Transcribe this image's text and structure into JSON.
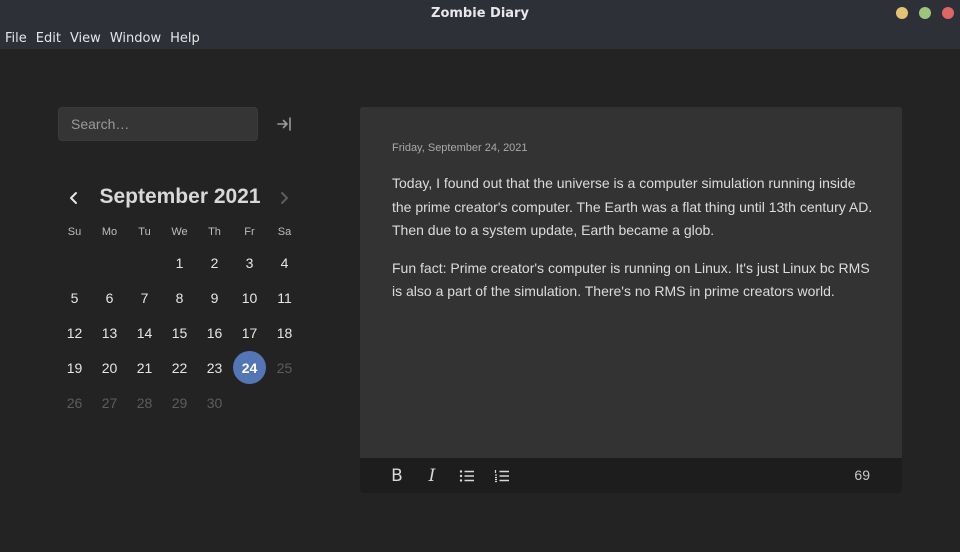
{
  "window": {
    "title": "Zombie Diary",
    "controls": [
      {
        "name": "minimize",
        "color": "#e6c374"
      },
      {
        "name": "maximize",
        "color": "#9cc47a"
      },
      {
        "name": "close",
        "color": "#e06666"
      }
    ]
  },
  "menu": [
    "File",
    "Edit",
    "View",
    "Window",
    "Help"
  ],
  "sidebar": {
    "search_placeholder": "Search…",
    "collapse_icon": "collapse-right-icon"
  },
  "calendar": {
    "month_label": "September 2021",
    "weekdays": [
      "Su",
      "Mo",
      "Tu",
      "We",
      "Th",
      "Fr",
      "Sa"
    ],
    "weeks": [
      [
        {
          "d": ""
        },
        {
          "d": ""
        },
        {
          "d": ""
        },
        {
          "d": "1"
        },
        {
          "d": "2"
        },
        {
          "d": "3"
        },
        {
          "d": "4"
        }
      ],
      [
        {
          "d": "5"
        },
        {
          "d": "6"
        },
        {
          "d": "7"
        },
        {
          "d": "8"
        },
        {
          "d": "9"
        },
        {
          "d": "10"
        },
        {
          "d": "11"
        }
      ],
      [
        {
          "d": "12"
        },
        {
          "d": "13"
        },
        {
          "d": "14"
        },
        {
          "d": "15"
        },
        {
          "d": "16"
        },
        {
          "d": "17"
        },
        {
          "d": "18"
        }
      ],
      [
        {
          "d": "19"
        },
        {
          "d": "20"
        },
        {
          "d": "21"
        },
        {
          "d": "22"
        },
        {
          "d": "23"
        },
        {
          "d": "24",
          "selected": true
        },
        {
          "d": "25",
          "muted": true
        }
      ],
      [
        {
          "d": "26",
          "muted": true
        },
        {
          "d": "27",
          "muted": true
        },
        {
          "d": "28",
          "muted": true
        },
        {
          "d": "29",
          "muted": true
        },
        {
          "d": "30",
          "muted": true
        },
        {
          "d": ""
        },
        {
          "d": ""
        }
      ]
    ],
    "selected_color": "#5476b5"
  },
  "entry": {
    "date": "Friday, September 24, 2021",
    "paragraphs": [
      "Today, I found out that the universe is a computer simulation running inside the prime creator's computer. The Earth was a flat thing until 13th century AD. Then due to a system update, Earth became a glob.",
      "Fun fact: Prime creator's computer is running on Linux. It's just Linux bc RMS is also a part of the simulation. There's no RMS in prime creators world."
    ]
  },
  "toolbar": {
    "bold_label": "B",
    "italic_label": "I",
    "word_count": "69"
  }
}
